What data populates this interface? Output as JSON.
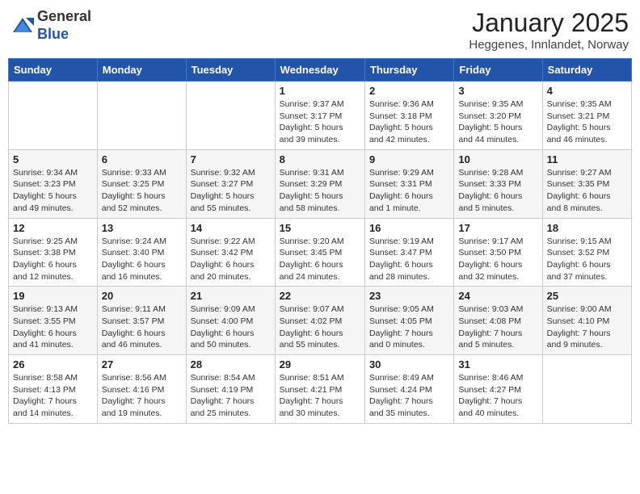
{
  "header": {
    "logo_general": "General",
    "logo_blue": "Blue",
    "month_title": "January 2025",
    "location": "Heggenes, Innlandet, Norway"
  },
  "weekdays": [
    "Sunday",
    "Monday",
    "Tuesday",
    "Wednesday",
    "Thursday",
    "Friday",
    "Saturday"
  ],
  "weeks": [
    [
      {
        "day": "",
        "info": ""
      },
      {
        "day": "",
        "info": ""
      },
      {
        "day": "",
        "info": ""
      },
      {
        "day": "1",
        "info": "Sunrise: 9:37 AM\nSunset: 3:17 PM\nDaylight: 5 hours\nand 39 minutes."
      },
      {
        "day": "2",
        "info": "Sunrise: 9:36 AM\nSunset: 3:18 PM\nDaylight: 5 hours\nand 42 minutes."
      },
      {
        "day": "3",
        "info": "Sunrise: 9:35 AM\nSunset: 3:20 PM\nDaylight: 5 hours\nand 44 minutes."
      },
      {
        "day": "4",
        "info": "Sunrise: 9:35 AM\nSunset: 3:21 PM\nDaylight: 5 hours\nand 46 minutes."
      }
    ],
    [
      {
        "day": "5",
        "info": "Sunrise: 9:34 AM\nSunset: 3:23 PM\nDaylight: 5 hours\nand 49 minutes."
      },
      {
        "day": "6",
        "info": "Sunrise: 9:33 AM\nSunset: 3:25 PM\nDaylight: 5 hours\nand 52 minutes."
      },
      {
        "day": "7",
        "info": "Sunrise: 9:32 AM\nSunset: 3:27 PM\nDaylight: 5 hours\nand 55 minutes."
      },
      {
        "day": "8",
        "info": "Sunrise: 9:31 AM\nSunset: 3:29 PM\nDaylight: 5 hours\nand 58 minutes."
      },
      {
        "day": "9",
        "info": "Sunrise: 9:29 AM\nSunset: 3:31 PM\nDaylight: 6 hours\nand 1 minute."
      },
      {
        "day": "10",
        "info": "Sunrise: 9:28 AM\nSunset: 3:33 PM\nDaylight: 6 hours\nand 5 minutes."
      },
      {
        "day": "11",
        "info": "Sunrise: 9:27 AM\nSunset: 3:35 PM\nDaylight: 6 hours\nand 8 minutes."
      }
    ],
    [
      {
        "day": "12",
        "info": "Sunrise: 9:25 AM\nSunset: 3:38 PM\nDaylight: 6 hours\nand 12 minutes."
      },
      {
        "day": "13",
        "info": "Sunrise: 9:24 AM\nSunset: 3:40 PM\nDaylight: 6 hours\nand 16 minutes."
      },
      {
        "day": "14",
        "info": "Sunrise: 9:22 AM\nSunset: 3:42 PM\nDaylight: 6 hours\nand 20 minutes."
      },
      {
        "day": "15",
        "info": "Sunrise: 9:20 AM\nSunset: 3:45 PM\nDaylight: 6 hours\nand 24 minutes."
      },
      {
        "day": "16",
        "info": "Sunrise: 9:19 AM\nSunset: 3:47 PM\nDaylight: 6 hours\nand 28 minutes."
      },
      {
        "day": "17",
        "info": "Sunrise: 9:17 AM\nSunset: 3:50 PM\nDaylight: 6 hours\nand 32 minutes."
      },
      {
        "day": "18",
        "info": "Sunrise: 9:15 AM\nSunset: 3:52 PM\nDaylight: 6 hours\nand 37 minutes."
      }
    ],
    [
      {
        "day": "19",
        "info": "Sunrise: 9:13 AM\nSunset: 3:55 PM\nDaylight: 6 hours\nand 41 minutes."
      },
      {
        "day": "20",
        "info": "Sunrise: 9:11 AM\nSunset: 3:57 PM\nDaylight: 6 hours\nand 46 minutes."
      },
      {
        "day": "21",
        "info": "Sunrise: 9:09 AM\nSunset: 4:00 PM\nDaylight: 6 hours\nand 50 minutes."
      },
      {
        "day": "22",
        "info": "Sunrise: 9:07 AM\nSunset: 4:02 PM\nDaylight: 6 hours\nand 55 minutes."
      },
      {
        "day": "23",
        "info": "Sunrise: 9:05 AM\nSunset: 4:05 PM\nDaylight: 7 hours\nand 0 minutes."
      },
      {
        "day": "24",
        "info": "Sunrise: 9:03 AM\nSunset: 4:08 PM\nDaylight: 7 hours\nand 5 minutes."
      },
      {
        "day": "25",
        "info": "Sunrise: 9:00 AM\nSunset: 4:10 PM\nDaylight: 7 hours\nand 9 minutes."
      }
    ],
    [
      {
        "day": "26",
        "info": "Sunrise: 8:58 AM\nSunset: 4:13 PM\nDaylight: 7 hours\nand 14 minutes."
      },
      {
        "day": "27",
        "info": "Sunrise: 8:56 AM\nSunset: 4:16 PM\nDaylight: 7 hours\nand 19 minutes."
      },
      {
        "day": "28",
        "info": "Sunrise: 8:54 AM\nSunset: 4:19 PM\nDaylight: 7 hours\nand 25 minutes."
      },
      {
        "day": "29",
        "info": "Sunrise: 8:51 AM\nSunset: 4:21 PM\nDaylight: 7 hours\nand 30 minutes."
      },
      {
        "day": "30",
        "info": "Sunrise: 8:49 AM\nSunset: 4:24 PM\nDaylight: 7 hours\nand 35 minutes."
      },
      {
        "day": "31",
        "info": "Sunrise: 8:46 AM\nSunset: 4:27 PM\nDaylight: 7 hours\nand 40 minutes."
      },
      {
        "day": "",
        "info": ""
      }
    ]
  ]
}
